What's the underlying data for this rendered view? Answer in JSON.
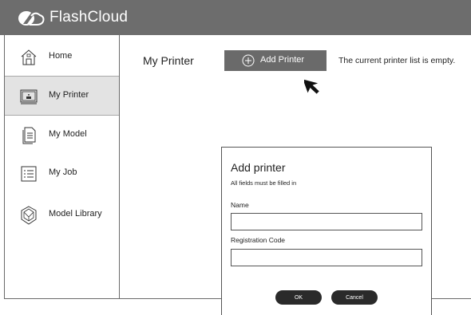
{
  "app": {
    "title": "FlashCloud"
  },
  "sidebar": {
    "items": [
      {
        "label": "Home",
        "icon": "home-icon",
        "active": false
      },
      {
        "label": "My Printer",
        "icon": "printer-icon",
        "active": true
      },
      {
        "label": "My Model",
        "icon": "document-icon",
        "active": false
      },
      {
        "label": "My Job",
        "icon": "job-list-icon",
        "active": false
      },
      {
        "label": "Model Library",
        "icon": "model-library-icon",
        "active": false
      }
    ]
  },
  "main": {
    "title": "My Printer",
    "add_printer_label": "Add Printer",
    "empty_message": "The current printer list is empty."
  },
  "dialog": {
    "title": "Add printer",
    "subtitle": "All fields must be filled in",
    "name_label": "Name",
    "name_value": "",
    "code_label": "Registration Code",
    "code_value": "",
    "ok_label": "OK",
    "cancel_label": "Cancel"
  },
  "colors": {
    "topbar": "#6d6d6d",
    "active_item": "#e3e3e3",
    "button": "#6a6a6a",
    "pill_button": "#2a2a2a"
  }
}
